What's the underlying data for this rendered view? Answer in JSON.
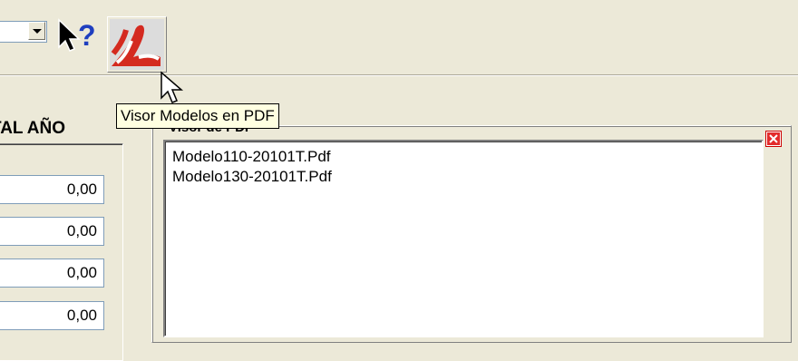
{
  "toolbar": {
    "combo_value": "",
    "help_icon": "whats-this-help-icon",
    "pdf_button_icon": "acrobat-pdf-icon",
    "pdf_button_tooltip": "Visor Modelos en PDF"
  },
  "left_pane": {
    "column_header": "TAL AÑO",
    "values": [
      "0,00",
      "0,00",
      "0,00",
      "0,00"
    ]
  },
  "pdf_panel": {
    "title": "Visor de PDF",
    "close_icon": "close-x-icon",
    "files": [
      "Modelo110-20101T.Pdf",
      "Modelo130-20101T.Pdf"
    ]
  },
  "colors": {
    "window_bg": "#ece9d8",
    "tooltip_bg": "#ffffe1",
    "pdf_red": "#d42a20",
    "close_red": "#cc0000"
  }
}
